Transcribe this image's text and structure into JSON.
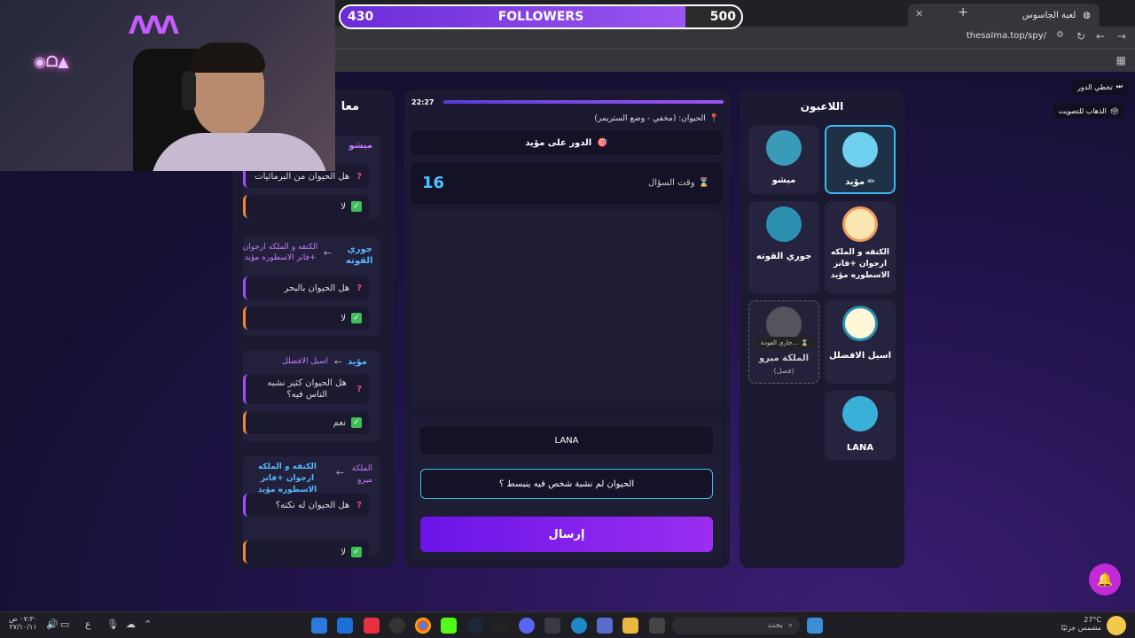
{
  "browser": {
    "tab_title": "لعبة الجاسوس",
    "url": "thesalma.top/spy/"
  },
  "followers": {
    "label": "FOLLOWERS",
    "current": "430",
    "goal": "500",
    "progress": 0.86
  },
  "side_buttons": {
    "skip": "تخطي الدور",
    "vote": "الذهاب للتصويت"
  },
  "players": {
    "title": "اللاعبون",
    "list": [
      {
        "name": "مؤيد",
        "edit_icon": "pencil-icon"
      },
      {
        "name": "ميشو"
      },
      {
        "name": "الكنقه و الملكه ارجوان +فانز الاسطوره مؤيد"
      },
      {
        "name": "جوري القوته"
      },
      {
        "name": "اسيل الافضلل"
      },
      {
        "name": "الملكة ميرو",
        "status": "(فصل)",
        "badge": "جاري العودة..."
      },
      {
        "name": "LANA"
      }
    ]
  },
  "game": {
    "timer": "22:27",
    "animal_label": "الحيوان: (مخفي - وضع الستريمر)",
    "turn_label": "الدور على مؤيد",
    "question_time_label": "وقت السؤال",
    "question_time_value": "16",
    "asker_name": "LANA",
    "input_value": "الحيوان لم نشبة شخص فيه ينبسط ؟",
    "send_label": "إرسال"
  },
  "log": {
    "title": "معا",
    "entries": [
      {
        "from": "ميشو",
        "question": "هل الحيوان من البرمائيات",
        "answer": "لا"
      },
      {
        "from": "جوري القوته",
        "to": "الكنقه و الملكه ارجوان +فانز الاسطوره مؤيد",
        "question": "هل الحيوان بالبحر",
        "answer": "لا"
      },
      {
        "from": "مؤيد",
        "to": "اسيل الافضلل",
        "question": "هل الحيوان كثير نشبه الناس فيه؟",
        "answer": "نعم"
      },
      {
        "from": "الملكة ميرو",
        "to": "الكنقه و الملكه ارجوان +فانز الاسطوره مؤيد",
        "question": "هل الحيوان له نكته؟",
        "answer": "لا"
      }
    ]
  },
  "taskbar": {
    "search_placeholder": "بحث",
    "weather_temp": "27°C",
    "weather_text": "مشمس جزئيًا",
    "time": "٠٧:٣٠ ص",
    "date": "٢٧/١٠/١١",
    "lang": "ع"
  }
}
